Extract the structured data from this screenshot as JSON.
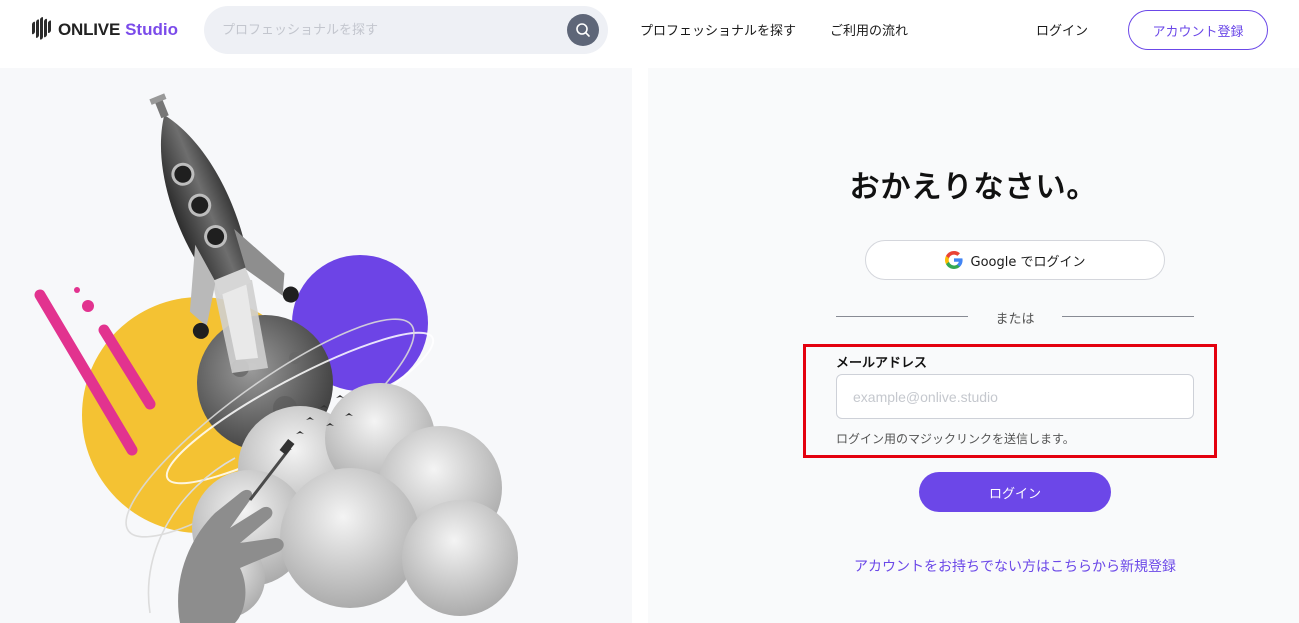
{
  "brand": {
    "name": "ONLIVE",
    "accent": "Studio",
    "brand_color": "#7b4bea"
  },
  "header": {
    "search_placeholder": "プロフェッショナルを探す",
    "search_icon": "search-icon",
    "nav_find": "プロフェッショナルを探す",
    "nav_flow": "ご利用の流れ",
    "nav_login": "ログイン",
    "register_label": "アカウント登録"
  },
  "login": {
    "heading": "おかえりなさい。",
    "google_button": "Google でログイン",
    "divider_text": "または",
    "email_label": "メールアドレス",
    "email_placeholder": "example@onlive.studio",
    "email_value": "",
    "email_help": "ログイン用のマジックリンクを送信します。",
    "submit_label": "ログイン",
    "signup_link": "アカウントをお持ちでない方はこちらから新規登録"
  },
  "colors": {
    "primary": "#6c47e8",
    "highlight": "#e4000f",
    "yellow": "#f4c233",
    "magenta": "#e2338f"
  }
}
